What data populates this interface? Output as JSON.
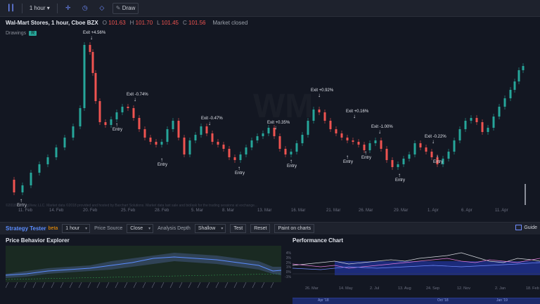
{
  "toolbar": {
    "interval": "1 hour",
    "draw_label": "Draw"
  },
  "legend": {
    "symbol": "Wal-Mart Stores, 1 hour, Cboe BZX",
    "o_label": "O",
    "o_value": "101.63",
    "h_label": "H",
    "h_value": "101.70",
    "l_label": "L",
    "l_value": "101.45",
    "c_label": "C",
    "c_value": "101.56",
    "status": "Market closed"
  },
  "drawings": {
    "label": "Drawings",
    "badge": "R"
  },
  "watermark": "WM",
  "disclaimer": "©2018 TradingView, LLC. Market data ©2018 provided and hosted by Barchart Solutions. Market data last sale and bid/ask for the trading sessions at exchange...",
  "x_axis": [
    "11. Feb",
    "14. Feb",
    "20. Feb",
    "25. Feb",
    "28. Feb",
    "5. Mar",
    "8. Mar",
    "13. Mar",
    "16. Mar",
    "21. Mar",
    "26. Mar",
    "29. Mar",
    "1. Apr",
    "6. Apr",
    "11. Apr"
  ],
  "annotations": [
    {
      "text": "Exit +4.56%",
      "kind": "exit"
    },
    {
      "text": "Exit -0.74%",
      "kind": "exit"
    },
    {
      "text": "Entry",
      "kind": "entry"
    },
    {
      "text": "Entry",
      "kind": "entry"
    },
    {
      "text": "Exit -0.47%",
      "kind": "exit"
    },
    {
      "text": "Entry",
      "kind": "entry"
    },
    {
      "text": "Exit +0.35%",
      "kind": "exit"
    },
    {
      "text": "Entry",
      "kind": "entry"
    },
    {
      "text": "Exit +0.92%",
      "kind": "exit"
    },
    {
      "text": "Exit +0.16%",
      "kind": "exit"
    },
    {
      "text": "Entry",
      "kind": "entry"
    },
    {
      "text": "Entry",
      "kind": "entry"
    },
    {
      "text": "Exit -1.00%",
      "kind": "exit"
    },
    {
      "text": "Entry",
      "kind": "entry"
    },
    {
      "text": "Exit -0.22%",
      "kind": "exit"
    },
    {
      "text": "Entry",
      "kind": "entry"
    },
    {
      "text": "Entry",
      "kind": "entry"
    }
  ],
  "strategy": {
    "title": "Strategy Tester",
    "beta": "beta",
    "interval": "1 hour",
    "price_source_label": "Price Source",
    "price_source_value": "Close",
    "analysis_depth_label": "Analysis Depth",
    "analysis_depth_value": "Shallow",
    "test_label": "Test",
    "reset_label": "Reset",
    "paint_label": "Paint on charts",
    "guide_label": "Guide"
  },
  "panels": {
    "pbe_title": "Price Behavior Explorer",
    "perf_title": "Performance Chart"
  },
  "perf": {
    "y_axis": [
      "4%",
      "3%",
      "2%",
      "1%",
      "0%",
      "-1%"
    ],
    "x_axis": [
      "26. Mar",
      "14. May",
      "2. Jul",
      "13. Aug",
      "24. Sep",
      "12. Nov",
      "2. Jan",
      "18. Feb"
    ],
    "nav_labels": [
      "Apr '18",
      "Oct '18",
      "Jan '19"
    ]
  },
  "colors": {
    "up": "#26a69a",
    "down": "#ef5350",
    "accent": "#5b8dff"
  }
}
